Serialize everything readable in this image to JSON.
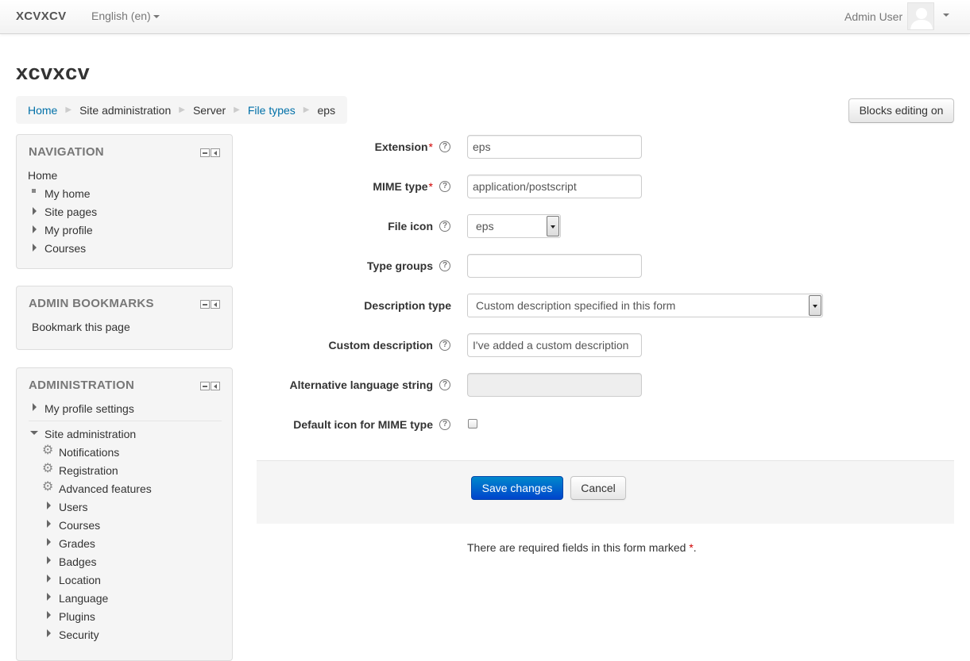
{
  "navbar": {
    "brand": "XCVXCV",
    "language": "English (en)",
    "user_name": "Admin User"
  },
  "page": {
    "title": "xcvxcv",
    "blocks_editing_label": "Blocks editing on"
  },
  "breadcrumb": {
    "items": [
      "Home",
      "Site administration",
      "Server",
      "File types",
      "eps"
    ]
  },
  "navigation_block": {
    "title": "NAVIGATION",
    "home": "Home",
    "items": [
      "My home",
      "Site pages",
      "My profile",
      "Courses"
    ]
  },
  "bookmarks_block": {
    "title": "ADMIN BOOKMARKS",
    "link": "Bookmark this page"
  },
  "administration_block": {
    "title": "ADMINISTRATION",
    "my_profile_settings": "My profile settings",
    "site_administration": "Site administration",
    "gear_items": [
      "Notifications",
      "Registration",
      "Advanced features"
    ],
    "folders": [
      "Users",
      "Courses",
      "Grades",
      "Badges",
      "Location",
      "Language",
      "Plugins",
      "Security"
    ]
  },
  "form": {
    "extension": {
      "label": "Extension",
      "value": "eps"
    },
    "mime_type": {
      "label": "MIME type",
      "value": "application/postscript"
    },
    "file_icon": {
      "label": "File icon",
      "value": "eps"
    },
    "type_groups": {
      "label": "Type groups",
      "value": ""
    },
    "description_type": {
      "label": "Description type",
      "value": "Custom description specified in this form"
    },
    "custom_description": {
      "label": "Custom description",
      "value": "I've added a custom description"
    },
    "alt_language_string": {
      "label": "Alternative language string",
      "value": ""
    },
    "default_icon": {
      "label": "Default icon for MIME type",
      "checked": false
    },
    "required_marker": "*",
    "help_glyph": "?",
    "save_label": "Save changes",
    "cancel_label": "Cancel",
    "required_note": "There are required fields in this form marked",
    "required_note_end": "."
  },
  "colors": {
    "link": "#0070a8",
    "primary_button": "#0066cc",
    "required": "#d00000",
    "block_background": "#f5f5f5"
  }
}
